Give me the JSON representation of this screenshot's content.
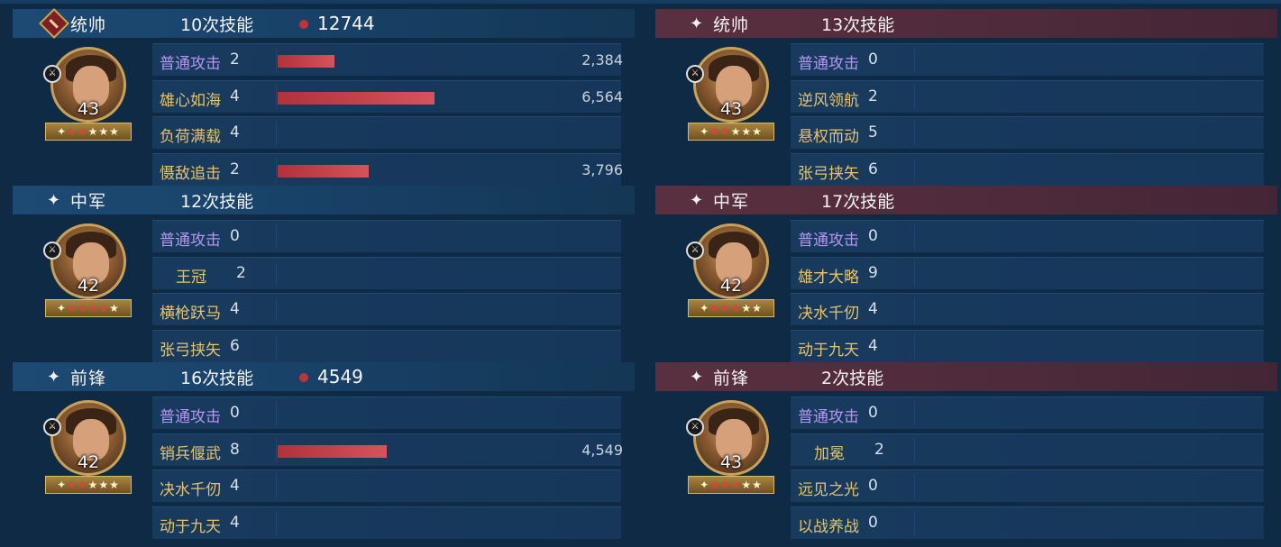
{
  "left": {
    "slots": [
      {
        "role": "统帅",
        "casts": "10次技能",
        "damage_total": "12744",
        "level": "43",
        "red_stars": 2,
        "portrait": "bearded-general-portrait",
        "skills": [
          {
            "name": "普通攻击",
            "level": "2",
            "type": "normal",
            "value": 2384,
            "value_label": "2,384"
          },
          {
            "name": "雄心如海",
            "level": "4",
            "type": "tactic",
            "value": 6564,
            "value_label": "6,564"
          },
          {
            "name": "负荷满载",
            "level": "4",
            "type": "tactic"
          },
          {
            "name": "慑敌追击",
            "level": "2",
            "type": "tactic",
            "value": 3796,
            "value_label": "3,796"
          }
        ]
      },
      {
        "role": "中军",
        "casts": "12次技能",
        "level": "42",
        "red_stars": 4,
        "portrait": "empress-portrait",
        "skills": [
          {
            "name": "普通攻击",
            "level": "0",
            "type": "normal"
          },
          {
            "name": "王冠",
            "level": "2",
            "type": "tactic",
            "indent": true
          },
          {
            "name": "横枪跃马",
            "level": "4",
            "type": "tactic"
          },
          {
            "name": "张弓挟矢",
            "level": "6",
            "type": "tactic"
          }
        ]
      },
      {
        "role": "前锋",
        "casts": "16次技能",
        "damage_total": "4549",
        "level": "42",
        "red_stars": 2,
        "portrait": "crowned-warrior-portrait",
        "skills": [
          {
            "name": "普通攻击",
            "level": "0",
            "type": "normal"
          },
          {
            "name": "销兵偃武",
            "level": "8",
            "type": "tactic",
            "value": 4549,
            "value_label": "4,549"
          },
          {
            "name": "决水千仞",
            "level": "4",
            "type": "tactic"
          },
          {
            "name": "动于九天",
            "level": "4",
            "type": "tactic"
          }
        ]
      }
    ]
  },
  "right": {
    "slots": [
      {
        "role": "统帅",
        "casts": "13次技能",
        "level": "43",
        "red_stars": 2,
        "portrait": "explorer-portrait",
        "skills": [
          {
            "name": "普通攻击",
            "level": "0",
            "type": "normal"
          },
          {
            "name": "逆风领航",
            "level": "2",
            "type": "tactic"
          },
          {
            "name": "悬权而动",
            "level": "5",
            "type": "tactic"
          },
          {
            "name": "张弓挟矢",
            "level": "6",
            "type": "tactic"
          }
        ]
      },
      {
        "role": "中军",
        "casts": "17次技能",
        "level": "42",
        "red_stars": 3,
        "portrait": "strategist-portrait",
        "skills": [
          {
            "name": "普通攻击",
            "level": "0",
            "type": "normal"
          },
          {
            "name": "雄才大略",
            "level": "9",
            "type": "tactic"
          },
          {
            "name": "决水千仞",
            "level": "4",
            "type": "tactic"
          },
          {
            "name": "动于九天",
            "level": "4",
            "type": "tactic"
          }
        ]
      },
      {
        "role": "前锋",
        "casts": "2次技能",
        "level": "43",
        "red_stars": 3,
        "portrait": "queen-portrait",
        "skills": [
          {
            "name": "普通攻击",
            "level": "0",
            "type": "normal"
          },
          {
            "name": "加冕",
            "level": "2",
            "type": "tactic",
            "indent": true
          },
          {
            "name": "远见之光",
            "level": "0",
            "type": "tactic"
          },
          {
            "name": "以战养战",
            "level": "0",
            "type": "tactic"
          }
        ]
      }
    ]
  },
  "bar_scale_max": 6564,
  "colors": {
    "bar": "#c0343c",
    "normal_skill": "#b497f0",
    "tactic_skill": "#e8c36b",
    "enemy_header": "#5a3040",
    "ally_header": "#1d4a73"
  }
}
